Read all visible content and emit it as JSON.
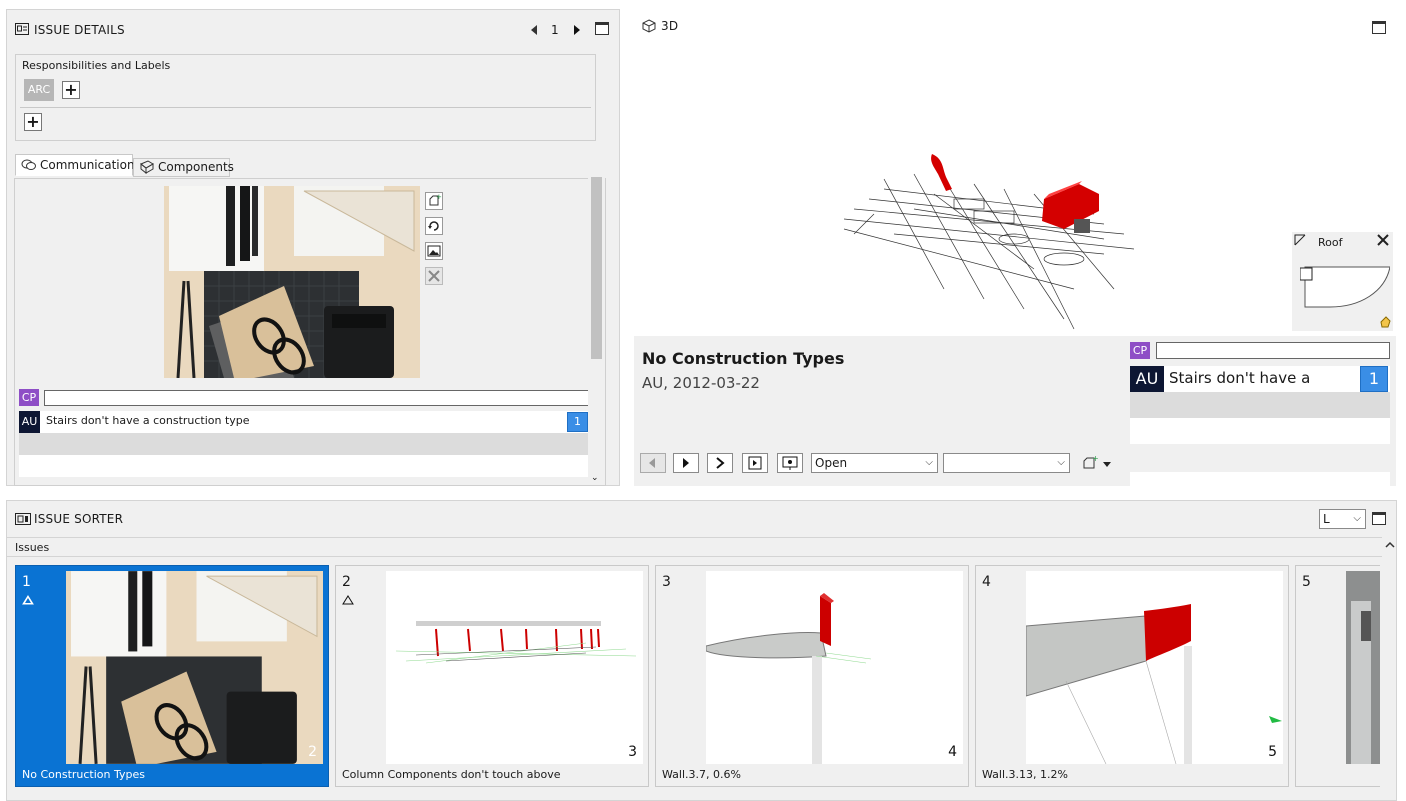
{
  "details": {
    "title": "ISSUE DETAILS",
    "page_number": "1",
    "responsibilities_label": "Responsibilities and Labels",
    "arc_tag": "ARC",
    "tabs": [
      "Communication",
      "Components"
    ],
    "comment": {
      "cp_tag": "CP",
      "au_tag": "AU",
      "text": "Stairs don't have a construction type",
      "count": "1"
    }
  },
  "view3d": {
    "title": "3D",
    "roof_label": "Roof"
  },
  "info": {
    "issue_title": "No Construction Types",
    "issue_meta": "AU, 2012-03-22",
    "status_value": "Open",
    "second_select_value": "",
    "comment": {
      "cp_tag": "CP",
      "au_tag": "AU",
      "text": "Stairs don't have a",
      "count": "1"
    }
  },
  "sorter": {
    "title": "ISSUE SORTER",
    "size_select": "L",
    "issues_label": "Issues",
    "cards": [
      {
        "num": "1",
        "count": "2",
        "caption": "No Construction Types",
        "selected": true
      },
      {
        "num": "2",
        "count": "3",
        "caption": "Column Components don't touch above",
        "selected": false
      },
      {
        "num": "3",
        "count": "4",
        "caption": "Wall.3.7, 0.6%",
        "selected": false
      },
      {
        "num": "4",
        "count": "5",
        "caption": "Wall.3.13, 1.2%",
        "selected": false
      },
      {
        "num": "5",
        "count": "",
        "caption": "",
        "selected": false
      }
    ]
  },
  "colors": {
    "selected_card": "#0a73d3",
    "cp_tag": "#8e4ec6",
    "au_tag": "#0d1633",
    "badge": "#3a8ee6",
    "model_red": "#d40000"
  }
}
